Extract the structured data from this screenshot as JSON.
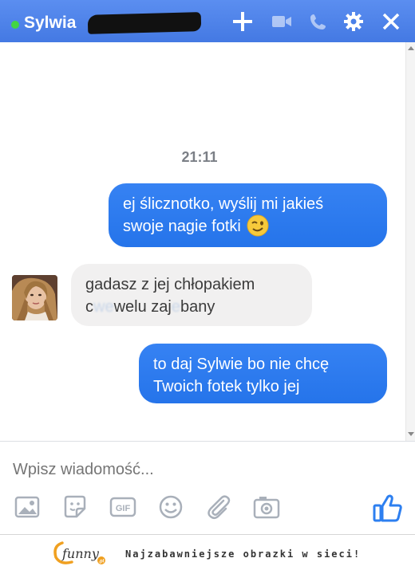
{
  "header": {
    "contact_name": "Sylwia",
    "online_status_color": "#42d544",
    "icons": [
      "plus-icon",
      "video-icon",
      "phone-icon",
      "gear-icon",
      "close-icon"
    ],
    "accent_color": "#4a86e8"
  },
  "chat": {
    "timestamp": "21:11",
    "messages": [
      {
        "direction": "outgoing",
        "lines": [
          "ej ślicznotko, wyślij mi jakieś",
          "swoje nagie fotki"
        ],
        "emoji": "wink"
      },
      {
        "direction": "incoming",
        "lines": [
          "gadasz z jej chłopakiem",
          "c",
          "welu zaj",
          "bany"
        ],
        "censored": [
          "we",
          "e"
        ]
      },
      {
        "direction": "outgoing",
        "lines": [
          "to daj Sylwie bo nie chcę",
          "Twoich fotek tylko jej"
        ]
      }
    ]
  },
  "composer": {
    "placeholder": "Wpisz wiadomość...",
    "tools": [
      "image-icon",
      "sticker-icon",
      "gif-icon",
      "emoji-icon",
      "attachment-icon",
      "camera-icon"
    ],
    "like_icon": "thumbs-up-icon"
  },
  "footer": {
    "logo_text": "funny",
    "logo_suffix": ".pl",
    "tagline": "Najzabawniejsze obrazki w sieci!"
  }
}
